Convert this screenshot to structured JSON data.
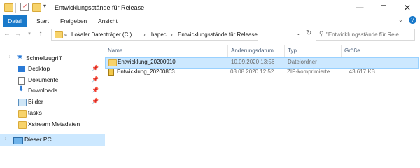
{
  "window": {
    "title": "Entwicklungsstände für Release",
    "controls": [
      "minimize-icon",
      "maximize-icon",
      "close-icon"
    ]
  },
  "ribbon": {
    "tabs": [
      "Datei",
      "Start",
      "Freigeben",
      "Ansicht"
    ]
  },
  "address": {
    "crumbs": [
      "Lokaler Datenträger (C:)",
      "hapec",
      "Entwicklungsstände für Release"
    ]
  },
  "search": {
    "placeholder": "\"Entwicklungsstände für Rele..."
  },
  "sidebar": {
    "quick_access": "Schnellzugriff",
    "items": [
      {
        "label": "Desktop",
        "pinned": true,
        "icon": "desktop-icon"
      },
      {
        "label": "Dokumente",
        "pinned": true,
        "icon": "documents-icon"
      },
      {
        "label": "Downloads",
        "pinned": true,
        "icon": "download-icon"
      },
      {
        "label": "Bilder",
        "pinned": true,
        "icon": "pictures-icon"
      },
      {
        "label": "tasks",
        "pinned": false,
        "icon": "folder-icon"
      },
      {
        "label": "Xstream Metadaten",
        "pinned": false,
        "icon": "folder-icon"
      }
    ],
    "this_pc": "Dieser PC"
  },
  "filelist": {
    "columns": [
      "Name",
      "Änderungsdatum",
      "Typ",
      "Größe"
    ],
    "rows": [
      {
        "name": "Entwicklung_20200910",
        "date": "10.09.2020 13:56",
        "type": "Dateiordner",
        "size": "",
        "icon": "folder-icon",
        "selected": true
      },
      {
        "name": "Entwicklung_20200803",
        "date": "03.08.2020 12:52",
        "type": "ZIP-komprimierte...",
        "size": "43.617 KB",
        "icon": "zip-icon",
        "selected": false
      }
    ]
  },
  "colors": {
    "accent": "#1979ca",
    "selection": "#cce8ff",
    "folder": "#f7d36b"
  }
}
